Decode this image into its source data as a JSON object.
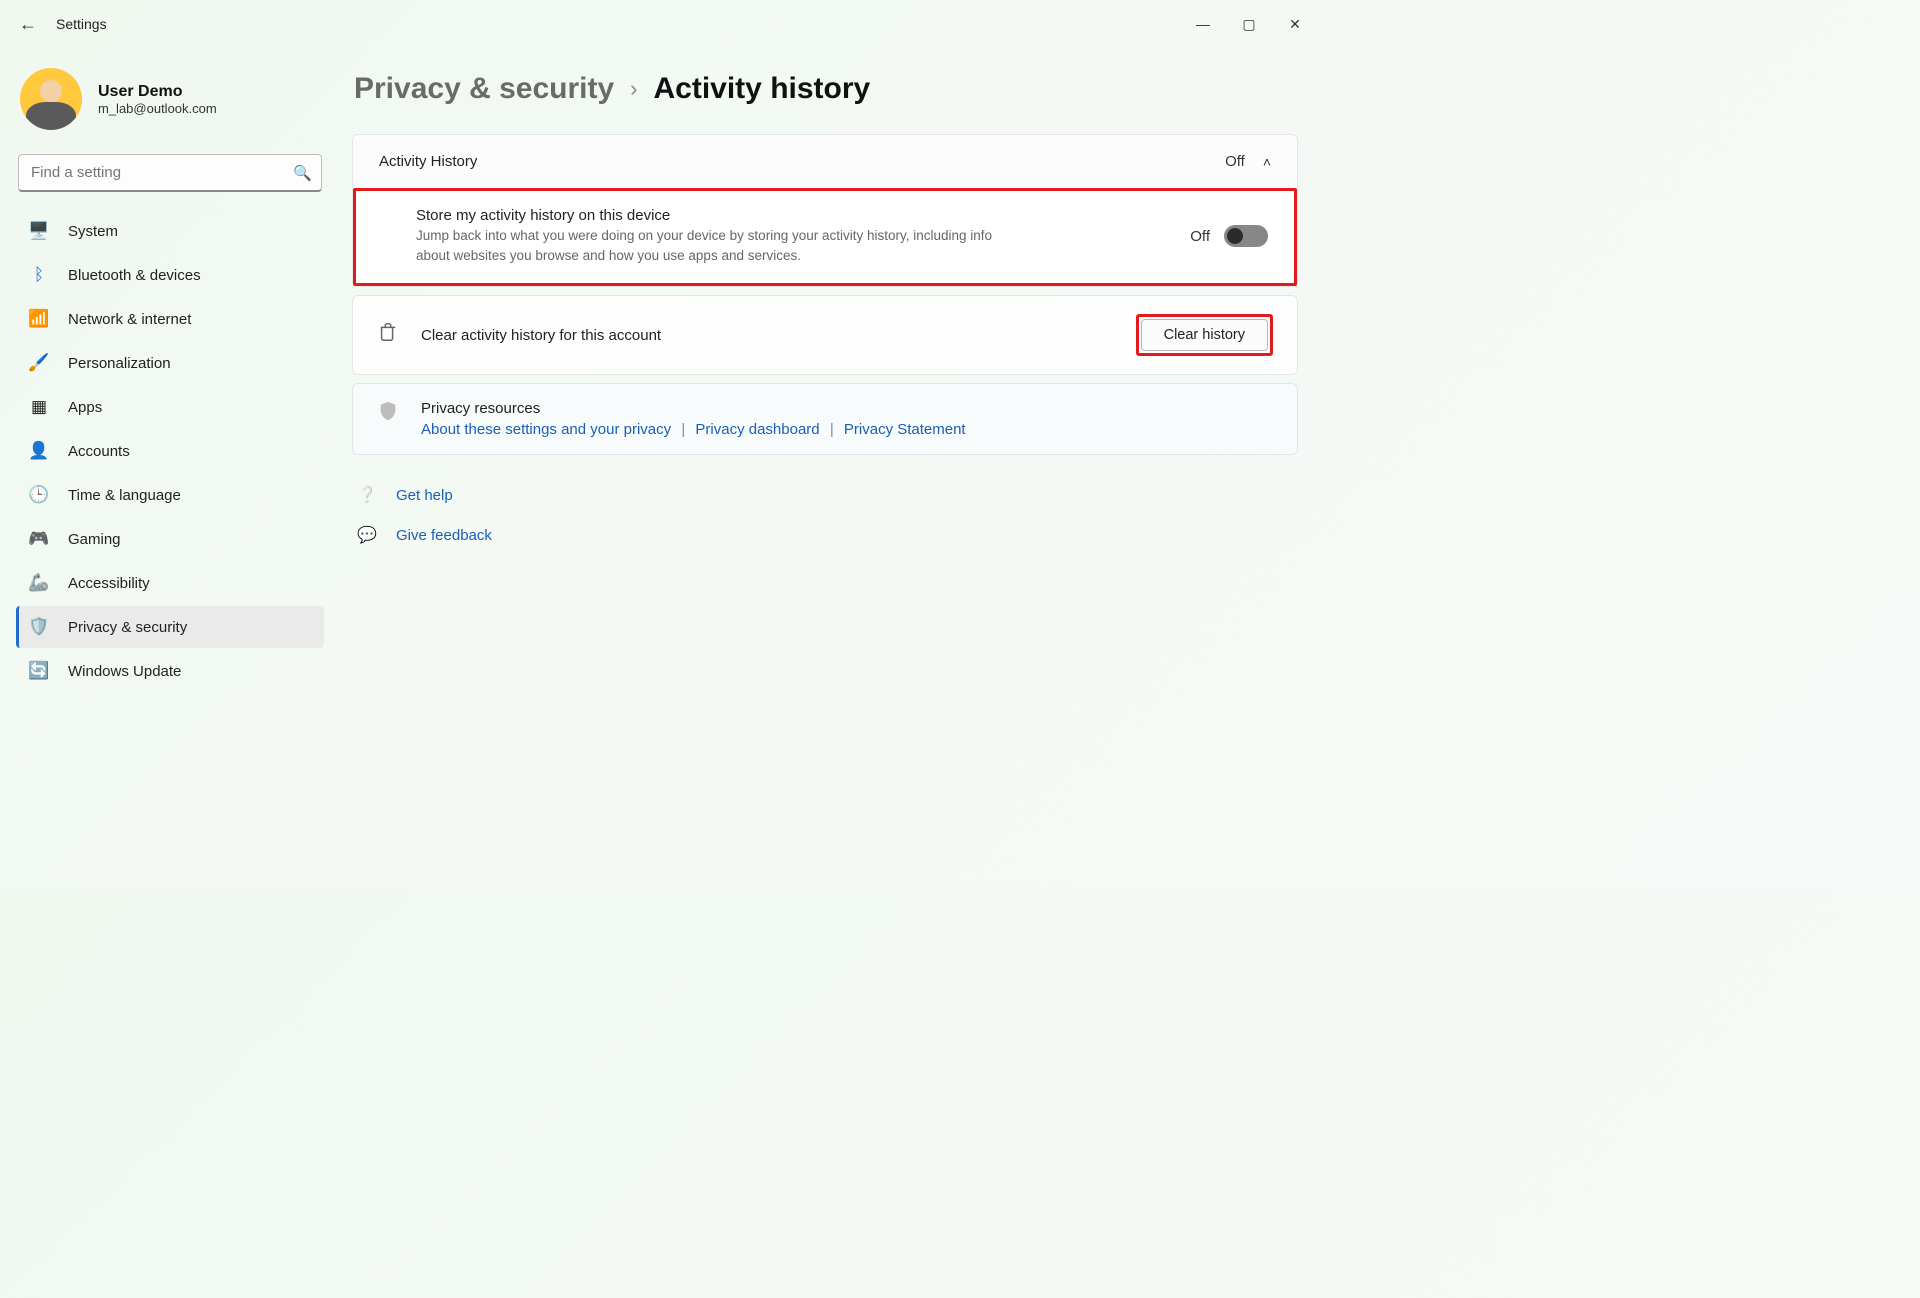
{
  "window": {
    "app_title": "Settings"
  },
  "profile": {
    "name": "User Demo",
    "email": "m_lab@outlook.com"
  },
  "search": {
    "placeholder": "Find a setting"
  },
  "sidebar": {
    "items": [
      {
        "label": "System"
      },
      {
        "label": "Bluetooth & devices"
      },
      {
        "label": "Network & internet"
      },
      {
        "label": "Personalization"
      },
      {
        "label": "Apps"
      },
      {
        "label": "Accounts"
      },
      {
        "label": "Time & language"
      },
      {
        "label": "Gaming"
      },
      {
        "label": "Accessibility"
      },
      {
        "label": "Privacy & security"
      },
      {
        "label": "Windows Update"
      }
    ]
  },
  "breadcrumb": {
    "parent": "Privacy & security",
    "current": "Activity history"
  },
  "activity_history": {
    "header_title": "Activity History",
    "header_status": "Off",
    "store": {
      "title": "Store my activity history on this device",
      "description": "Jump back into what you were doing on your device by storing your activity history, including info about websites you browse and how you use apps and services.",
      "status": "Off"
    },
    "clear_row_label": "Clear activity history for this account",
    "clear_button": "Clear history",
    "resources_title": "Privacy resources",
    "resources_links": {
      "about": "About these settings and your privacy",
      "dashboard": "Privacy dashboard",
      "statement": "Privacy Statement"
    }
  },
  "footer": {
    "get_help": "Get help",
    "give_feedback": "Give feedback"
  }
}
